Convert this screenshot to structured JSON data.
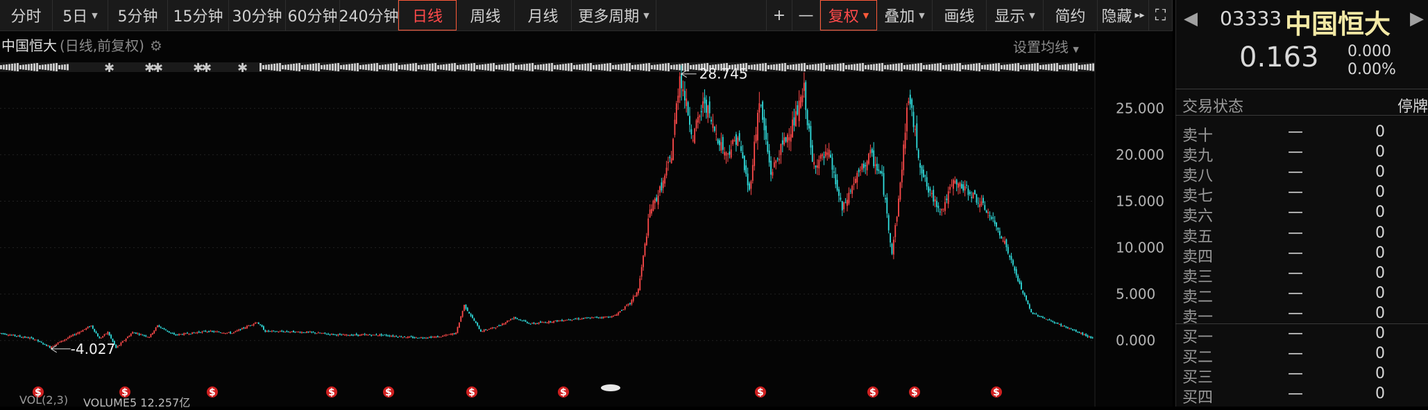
{
  "toolbar": {
    "periods": [
      "分时",
      "5日",
      "5分钟",
      "15分钟",
      "30分钟",
      "60分钟",
      "240分钟",
      "日线",
      "周线",
      "月线",
      "更多周期"
    ],
    "active_period": "日线",
    "plus": "+",
    "minus": "—",
    "adjust": "复权",
    "overlay": "叠加",
    "draw": "画线",
    "display": "显示",
    "simple": "简约",
    "hide": "隐藏",
    "more_glyph": "▸▸",
    "fullscreen_glyph": "⛶"
  },
  "legend": {
    "name": "中国恒大",
    "detail": "(日线,前复权)"
  },
  "set_ma": "设置均线",
  "chart_data": {
    "type": "candlestick",
    "y_ticks": [
      "25.000",
      "20.000",
      "15.000",
      "10.000",
      "5.000",
      "0.000"
    ],
    "y_tick_values": [
      25,
      20,
      15,
      10,
      5,
      0
    ],
    "ylim": [
      -3.6,
      29.5
    ],
    "grid": true,
    "max_label": "28.745",
    "min_label": "4.027",
    "series_trend": [
      [
        0,
        0.8
      ],
      [
        20,
        0.2
      ],
      [
        30,
        -0.7
      ],
      [
        40,
        0.2
      ],
      [
        55,
        1.6
      ],
      [
        60,
        0.2
      ],
      [
        65,
        0.9
      ],
      [
        70,
        -0.8
      ],
      [
        80,
        0.9
      ],
      [
        90,
        0.4
      ],
      [
        95,
        1.6
      ],
      [
        105,
        0.6
      ],
      [
        125,
        1.0
      ],
      [
        140,
        0.8
      ],
      [
        155,
        2.0
      ],
      [
        160,
        1.0
      ],
      [
        185,
        0.9
      ],
      [
        205,
        0.6
      ],
      [
        230,
        0.6
      ],
      [
        250,
        0.3
      ],
      [
        265,
        0.4
      ],
      [
        275,
        0.8
      ],
      [
        280,
        3.8
      ],
      [
        290,
        1.0
      ],
      [
        300,
        1.5
      ],
      [
        310,
        2.5
      ],
      [
        320,
        1.8
      ],
      [
        330,
        2.0
      ],
      [
        345,
        2.3
      ],
      [
        370,
        2.6
      ],
      [
        380,
        4.0
      ],
      [
        385,
        5.5
      ],
      [
        388,
        9.0
      ],
      [
        392,
        14.0
      ],
      [
        395,
        15.0
      ],
      [
        400,
        17.0
      ],
      [
        405,
        20.0
      ],
      [
        410,
        28.7
      ],
      [
        418,
        22.0
      ],
      [
        425,
        25.8
      ],
      [
        430,
        23.0
      ],
      [
        438,
        20.0
      ],
      [
        445,
        22.0
      ],
      [
        452,
        16.0
      ],
      [
        458,
        26.0
      ],
      [
        465,
        18.0
      ],
      [
        472,
        21.0
      ],
      [
        480,
        24.0
      ],
      [
        485,
        27.0
      ],
      [
        490,
        19.0
      ],
      [
        500,
        20.0
      ],
      [
        508,
        14.0
      ],
      [
        515,
        17.0
      ],
      [
        525,
        20.0
      ],
      [
        532,
        17.5
      ],
      [
        538,
        9.5
      ],
      [
        542,
        15.0
      ],
      [
        548,
        26.5
      ],
      [
        555,
        19.0
      ],
      [
        560,
        16.0
      ],
      [
        568,
        14.0
      ],
      [
        575,
        17.0
      ],
      [
        585,
        16.0
      ],
      [
        595,
        14.0
      ],
      [
        605,
        11.0
      ],
      [
        615,
        6.0
      ],
      [
        622,
        3.0
      ],
      [
        635,
        2.0
      ],
      [
        642,
        1.5
      ],
      [
        660,
        0.163
      ]
    ],
    "dividend_marks": 12
  },
  "bottom": {
    "vol_label": "VOL(2,3)",
    "vol_value": "VOLUME5 12.257亿"
  },
  "quote": {
    "code": "03333",
    "name": "中国恒大",
    "price": "0.163",
    "change": "0.000",
    "pct": "0.00%",
    "nav_prev": "◀",
    "nav_next": "▶"
  },
  "trade_status": {
    "label": "交易状态",
    "value": "停牌"
  },
  "orderbook": [
    {
      "label": "卖十",
      "price": "—",
      "vol": "0"
    },
    {
      "label": "卖九",
      "price": "—",
      "vol": "0"
    },
    {
      "label": "卖八",
      "price": "—",
      "vol": "0"
    },
    {
      "label": "卖七",
      "price": "—",
      "vol": "0"
    },
    {
      "label": "卖六",
      "price": "—",
      "vol": "0"
    },
    {
      "label": "卖五",
      "price": "—",
      "vol": "0"
    },
    {
      "label": "卖四",
      "price": "—",
      "vol": "0"
    },
    {
      "label": "卖三",
      "price": "—",
      "vol": "0"
    },
    {
      "label": "卖二",
      "price": "—",
      "vol": "0"
    },
    {
      "label": "卖一",
      "price": "—",
      "vol": "0"
    },
    {
      "label": "买一",
      "price": "—",
      "vol": "0"
    },
    {
      "label": "买二",
      "price": "—",
      "vol": "0"
    },
    {
      "label": "买三",
      "price": "—",
      "vol": "0"
    },
    {
      "label": "买四",
      "price": "—",
      "vol": "0"
    }
  ],
  "colors": {
    "up": "#ff4a4a",
    "down": "#31e0e0",
    "accent": "#ff5a3a",
    "name_yellow": "#f3e9a5"
  }
}
